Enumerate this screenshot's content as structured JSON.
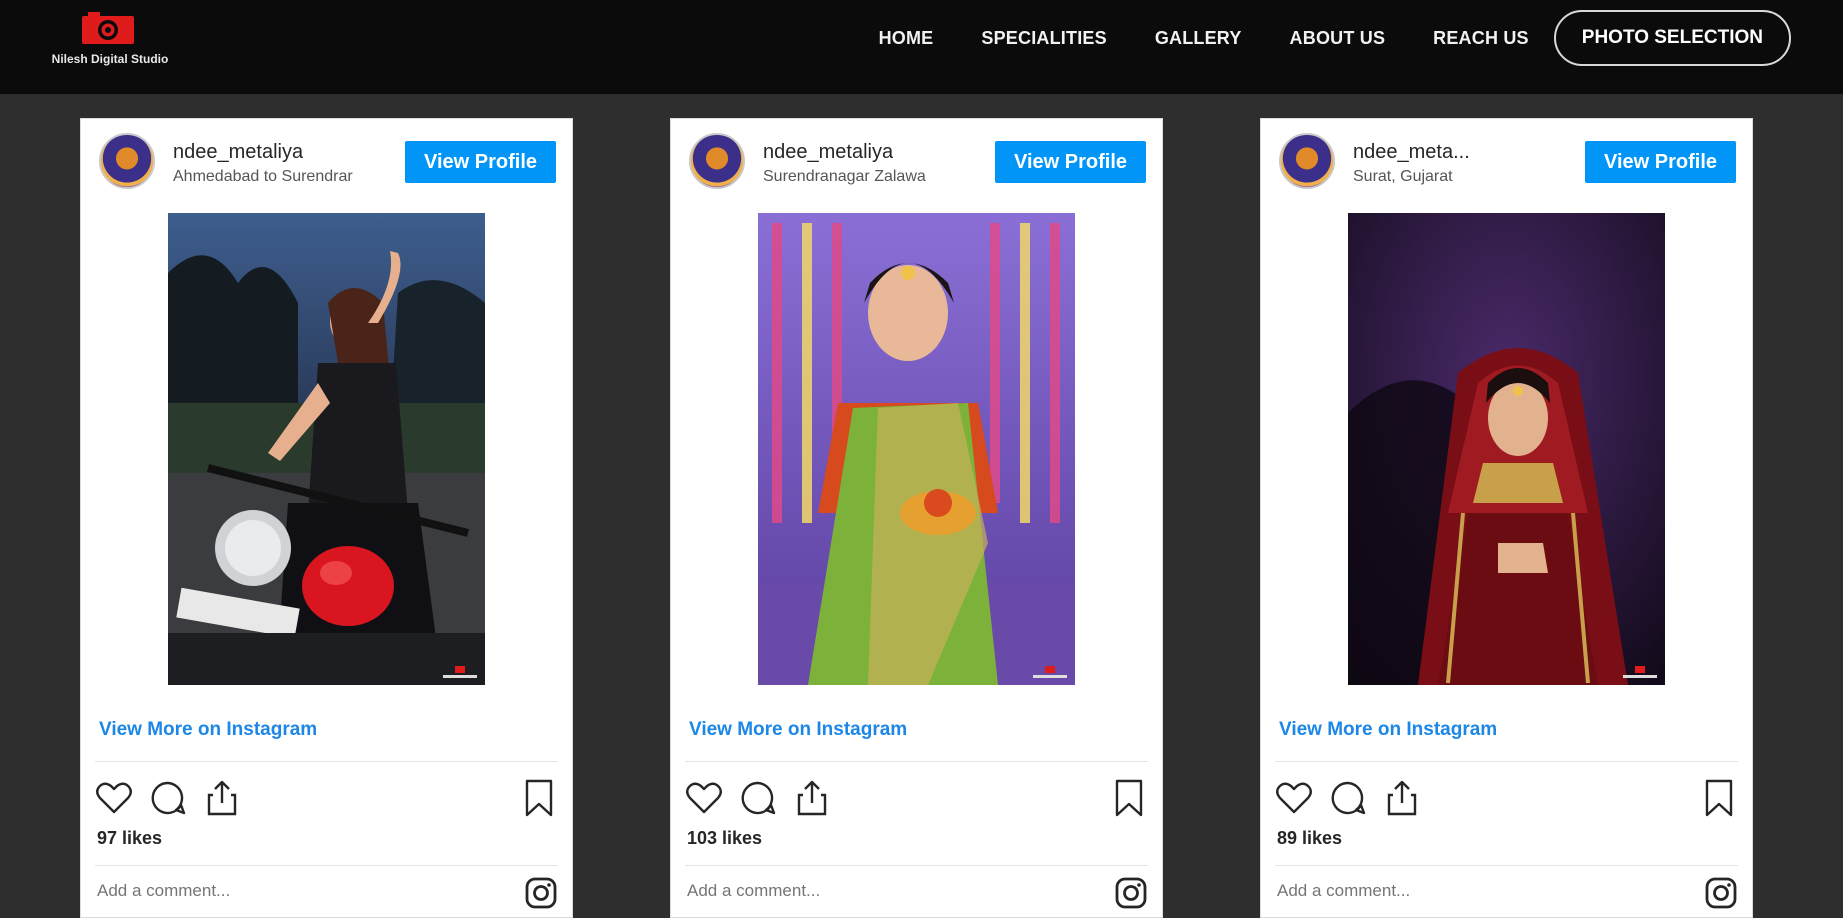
{
  "site": {
    "logo_text": "Nilesh Digital Studio",
    "accent": "#e01b1b"
  },
  "nav": {
    "items": [
      {
        "label": "HOME"
      },
      {
        "label": "SPECIALITIES"
      },
      {
        "label": "GALLERY"
      },
      {
        "label": "ABOUT US"
      },
      {
        "label": "REACH US"
      }
    ],
    "cta_label": "PHOTO SELECTION"
  },
  "feed": {
    "view_profile_label": "View Profile",
    "view_more_label": "View More on Instagram",
    "comment_placeholder": "Add a comment...",
    "posts": [
      {
        "username": "ndee_metaliya",
        "location": "Ahmedabad to Surendrar",
        "likes": "97 likes",
        "photo_icon": "photo-woman-motorbike"
      },
      {
        "username": "ndee_metaliya",
        "location": "Surendranagar Zalawa",
        "likes": "103 likes",
        "photo_icon": "photo-woman-saree"
      },
      {
        "username": "ndee_meta...",
        "location": "Surat, Gujarat",
        "likes": "89 likes",
        "photo_icon": "photo-bride-red"
      }
    ]
  },
  "colors": {
    "instagram_blue": "#0095f6",
    "link_blue": "#1c87e6",
    "page_bg": "#2e2e2e",
    "topbar_bg": "#0b0b0b"
  }
}
